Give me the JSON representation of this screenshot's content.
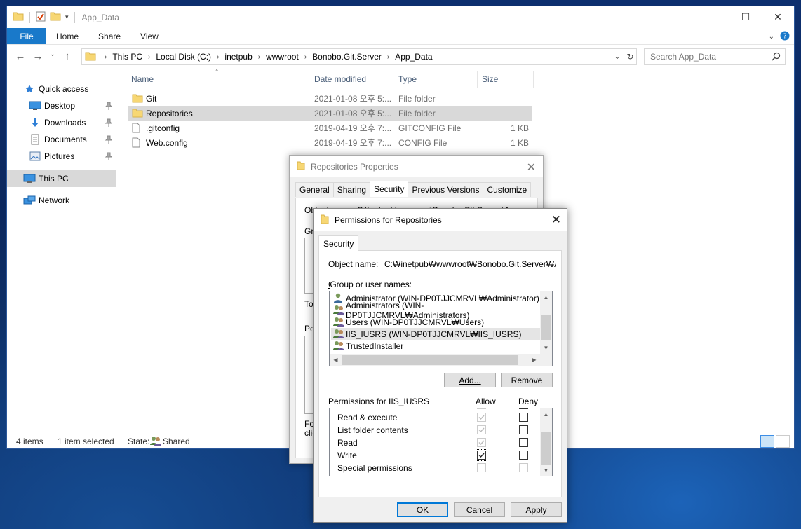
{
  "window": {
    "title": "App_Data",
    "controls": {
      "minimize": "—",
      "maximize": "☐",
      "close": "✕"
    }
  },
  "ribbon": {
    "tabs": [
      "File",
      "Home",
      "Share",
      "View"
    ]
  },
  "address": {
    "crumbs": [
      "This PC",
      "Local Disk (C:)",
      "inetpub",
      "wwwroot",
      "Bonobo.Git.Server",
      "App_Data"
    ],
    "search_placeholder": "Search App_Data"
  },
  "nav": {
    "items": [
      {
        "label": "Quick access",
        "icon": "star-icon"
      },
      {
        "label": "Desktop",
        "icon": "desktop-icon",
        "pinned": true
      },
      {
        "label": "Downloads",
        "icon": "download-icon",
        "pinned": true
      },
      {
        "label": "Documents",
        "icon": "documents-icon",
        "pinned": true
      },
      {
        "label": "Pictures",
        "icon": "pictures-icon",
        "pinned": true
      },
      {
        "label": "This PC",
        "icon": "computer-icon",
        "selected": true
      },
      {
        "label": "Network",
        "icon": "network-icon"
      }
    ]
  },
  "columns": {
    "name": "Name",
    "date": "Date modified",
    "type": "Type",
    "size": "Size"
  },
  "files": [
    {
      "name": "Git",
      "date": "2021-01-08 오후 5:...",
      "type": "File folder",
      "size": "",
      "icon": "folder-icon"
    },
    {
      "name": "Repositories",
      "date": "2021-01-08 오후 5:...",
      "type": "File folder",
      "size": "",
      "icon": "folder-icon",
      "selected": true
    },
    {
      "name": ".gitconfig",
      "date": "2019-04-19 오후 7:...",
      "type": "GITCONFIG File",
      "size": "1 KB",
      "icon": "file-icon"
    },
    {
      "name": "Web.config",
      "date": "2019-04-19 오후 7:...",
      "type": "CONFIG File",
      "size": "1 KB",
      "icon": "file-icon"
    }
  ],
  "status": {
    "count": "4 items",
    "selected": "1 item selected",
    "state_label": "State:",
    "state_value": "Shared"
  },
  "props_dialog": {
    "title": "Repositories Properties",
    "tabs": [
      "General",
      "Sharing",
      "Security",
      "Previous Versions",
      "Customize"
    ],
    "active_tab": "Security",
    "obscured_lines": [
      "Object name:    C:\\inetpub\\wwwroot\\Bonobo.Git.Server\\App",
      "Gro",
      "To",
      "Pe",
      "Fo",
      "clic"
    ]
  },
  "perm_dialog": {
    "title": "Permissions for Repositories",
    "tab": "Security",
    "object_label": "Object name:",
    "object_value": "C:₩inetpub₩wwwroot₩Bonobo.Git.Server₩App_",
    "group_label": "Group or user names:",
    "users": [
      {
        "name": "Administrator (WIN-DP0TJJCMRVL₩Administrator)",
        "icon": "user-icon"
      },
      {
        "name": "Administrators (WIN-DP0TJJCMRVL₩Administrators)",
        "icon": "users-icon"
      },
      {
        "name": "Users (WIN-DP0TJJCMRVL₩Users)",
        "icon": "users-icon"
      },
      {
        "name": "IIS_IUSRS (WIN-DP0TJJCMRVL₩IIS_IUSRS)",
        "icon": "users-icon",
        "selected": true
      },
      {
        "name": "TrustedInstaller",
        "icon": "users-icon"
      }
    ],
    "add_label": "Add...",
    "remove_label": "Remove",
    "perm_header": "Permissions for IIS_IUSRS",
    "allow_header": "Allow",
    "deny_header": "Deny",
    "permissions": [
      {
        "name": "Read & execute",
        "allow": "checked-disabled",
        "deny": "unchecked"
      },
      {
        "name": "List folder contents",
        "allow": "checked-disabled",
        "deny": "unchecked"
      },
      {
        "name": "Read",
        "allow": "checked-disabled",
        "deny": "unchecked"
      },
      {
        "name": "Write",
        "allow": "checked",
        "deny": "unchecked"
      },
      {
        "name": "Special permissions",
        "allow": "disabled",
        "deny": "disabled"
      }
    ],
    "ok_label": "OK",
    "cancel_label": "Cancel",
    "apply_label": "Apply"
  },
  "colors": {
    "accent": "#1979ca",
    "selection": "#d9d9d9",
    "folder": "#f7d774"
  }
}
